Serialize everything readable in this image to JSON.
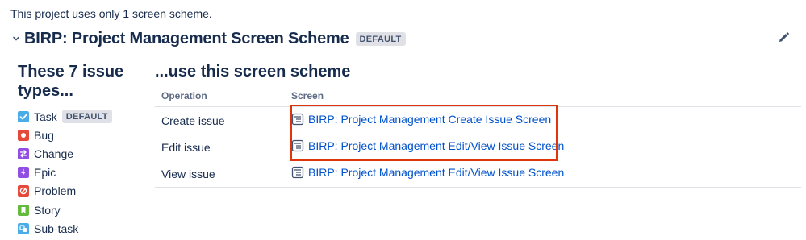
{
  "intro_text": "This project uses only 1 screen scheme.",
  "scheme": {
    "title": "BIRP: Project Management Screen Scheme",
    "badge": "DEFAULT"
  },
  "left": {
    "heading": "These 7 issue types...",
    "issue_types": [
      {
        "label": "Task",
        "icon": "task-icon",
        "color": "#4bade8",
        "badge": "DEFAULT"
      },
      {
        "label": "Bug",
        "icon": "bug-icon",
        "color": "#e5493a"
      },
      {
        "label": "Change",
        "icon": "change-icon",
        "color": "#904ee2"
      },
      {
        "label": "Epic",
        "icon": "epic-icon",
        "color": "#904ee2"
      },
      {
        "label": "Problem",
        "icon": "problem-icon",
        "color": "#e5493a"
      },
      {
        "label": "Story",
        "icon": "story-icon",
        "color": "#63ba3c"
      },
      {
        "label": "Sub-task",
        "icon": "subtask-icon",
        "color": "#4bade8"
      }
    ]
  },
  "right": {
    "heading": "...use this screen scheme",
    "columns": {
      "operation": "Operation",
      "screen": "Screen"
    },
    "rows": [
      {
        "operation": "Create issue",
        "screen": "BIRP: Project Management Create Issue Screen"
      },
      {
        "operation": "Edit issue",
        "screen": "BIRP: Project Management Edit/View Issue Screen"
      },
      {
        "operation": "View issue",
        "screen": "BIRP: Project Management Edit/View Issue Screen"
      }
    ]
  },
  "colors": {
    "link": "#0052cc",
    "highlight": "#de350b",
    "text": "#172b4d",
    "muted": "#5e6c84"
  }
}
